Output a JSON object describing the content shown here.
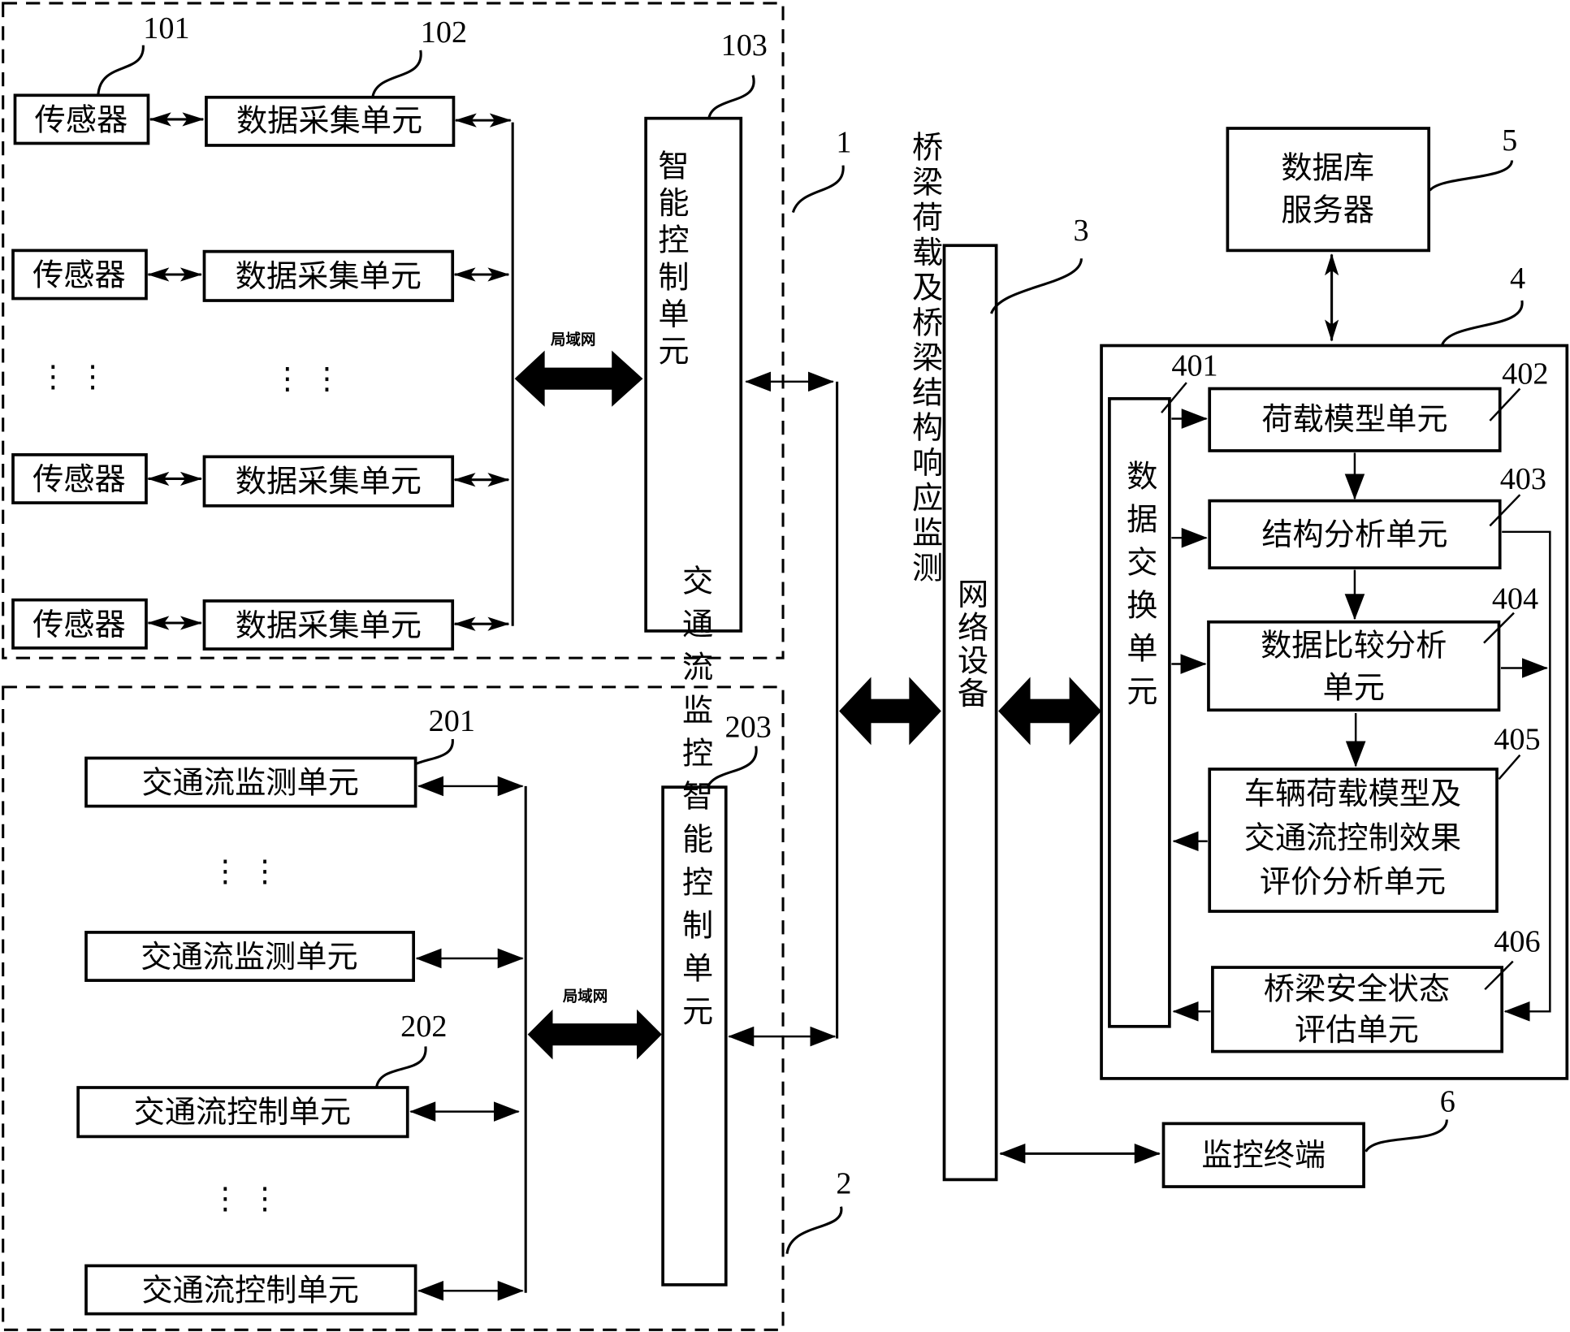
{
  "group1": {
    "ref": "1",
    "sensors": [
      "传感器",
      "传感器",
      "传感器",
      "传感器"
    ],
    "daq_units": [
      "数据采集单元",
      "数据采集单元",
      "数据采集单元",
      "数据采集单元"
    ],
    "sensor_ref": "101",
    "daq_ref": "102",
    "control_ref": "103",
    "control_col1": "桥梁荷载及桥梁结构响应监测",
    "control_col2": "智能控制单元",
    "lan_label": "局域网",
    "ellipsis": "⋮ ⋮"
  },
  "group2": {
    "ref": "2",
    "monitor_units": [
      "交通流监测单元",
      "交通流监测单元"
    ],
    "control_units": [
      "交通流控制单元",
      "交通流控制单元"
    ],
    "monitor_ref": "201",
    "control_unit_ref": "202",
    "control_ref": "203",
    "control_label": "交通流监控智能控制单元",
    "lan_label": "局域网",
    "ellipsis": "⋮ ⋮"
  },
  "network": {
    "ref": "3",
    "label": "网络设备"
  },
  "center": {
    "ref": "4",
    "exchange": {
      "ref": "401",
      "label": "数据交换单元"
    },
    "load_model": {
      "ref": "402",
      "label": "荷载模型单元"
    },
    "structure": {
      "ref": "403",
      "label": "结构分析单元"
    },
    "compare": {
      "ref": "404",
      "line1": "数据比较分析",
      "line2": "单元"
    },
    "evaluation": {
      "ref": "405",
      "line1": "车辆荷载模型及",
      "line2": "交通流控制效果",
      "line3": "评价分析单元"
    },
    "safety": {
      "ref": "406",
      "line1": "桥梁安全状态",
      "line2": "评估单元"
    }
  },
  "db_server": {
    "ref": "5",
    "line1": "数据库",
    "line2": "服务器"
  },
  "terminal": {
    "ref": "6",
    "label": "监控终端"
  }
}
